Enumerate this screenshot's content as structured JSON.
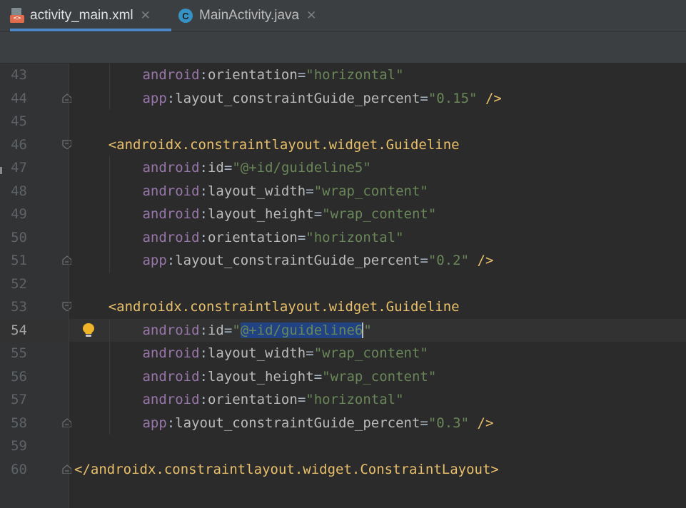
{
  "tabs": [
    {
      "label": "activity_main.xml",
      "icon": "xml-file-icon",
      "active": true,
      "close": "✕"
    },
    {
      "label": "MainActivity.java",
      "icon": "java-class-icon",
      "active": false,
      "close": "✕"
    }
  ],
  "java_icon_letter": "C",
  "xml_icon_text": "<>",
  "editor": {
    "current_line": 54,
    "lines": [
      {
        "n": "43",
        "tokens": [
          [
            "ns",
            "android"
          ],
          [
            "punct",
            ":"
          ],
          [
            "attr",
            "orientation"
          ],
          [
            "punct",
            "="
          ],
          [
            "val",
            "\"horizontal\""
          ]
        ]
      },
      {
        "n": "44",
        "tokens": [
          [
            "ns",
            "app"
          ],
          [
            "punct",
            ":"
          ],
          [
            "attr",
            "layout_constraintGuide_percent"
          ],
          [
            "punct",
            "="
          ],
          [
            "val",
            "\"0.15\""
          ],
          [
            "punct",
            " "
          ],
          [
            "tag",
            "/>"
          ]
        ]
      },
      {
        "n": "45",
        "tokens": []
      },
      {
        "n": "46",
        "tokens": [
          [
            "tag",
            "<androidx.constraintlayout.widget.Guideline"
          ]
        ]
      },
      {
        "n": "47",
        "tokens": [
          [
            "ns",
            "android"
          ],
          [
            "punct",
            ":"
          ],
          [
            "attr",
            "id"
          ],
          [
            "punct",
            "="
          ],
          [
            "val",
            "\"@+id/guideline5\""
          ]
        ]
      },
      {
        "n": "48",
        "tokens": [
          [
            "ns",
            "android"
          ],
          [
            "punct",
            ":"
          ],
          [
            "attr",
            "layout_width"
          ],
          [
            "punct",
            "="
          ],
          [
            "val",
            "\"wrap_content\""
          ]
        ]
      },
      {
        "n": "49",
        "tokens": [
          [
            "ns",
            "android"
          ],
          [
            "punct",
            ":"
          ],
          [
            "attr",
            "layout_height"
          ],
          [
            "punct",
            "="
          ],
          [
            "val",
            "\"wrap_content\""
          ]
        ]
      },
      {
        "n": "50",
        "tokens": [
          [
            "ns",
            "android"
          ],
          [
            "punct",
            ":"
          ],
          [
            "attr",
            "orientation"
          ],
          [
            "punct",
            "="
          ],
          [
            "val",
            "\"horizontal\""
          ]
        ]
      },
      {
        "n": "51",
        "tokens": [
          [
            "ns",
            "app"
          ],
          [
            "punct",
            ":"
          ],
          [
            "attr",
            "layout_constraintGuide_percent"
          ],
          [
            "punct",
            "="
          ],
          [
            "val",
            "\"0.2\""
          ],
          [
            "punct",
            " "
          ],
          [
            "tag",
            "/>"
          ]
        ]
      },
      {
        "n": "52",
        "tokens": []
      },
      {
        "n": "53",
        "tokens": [
          [
            "tag",
            "<androidx.constraintlayout.widget.Guideline"
          ]
        ]
      },
      {
        "n": "54",
        "tokens": [
          [
            "ns",
            "android"
          ],
          [
            "punct",
            ":"
          ],
          [
            "attr",
            "id"
          ],
          [
            "punct",
            "="
          ],
          [
            "val",
            "\""
          ],
          [
            "sel",
            "@+id/guideline6"
          ],
          [
            "caret",
            ""
          ],
          [
            "val",
            "\""
          ]
        ]
      },
      {
        "n": "55",
        "tokens": [
          [
            "ns",
            "android"
          ],
          [
            "punct",
            ":"
          ],
          [
            "attr",
            "layout_width"
          ],
          [
            "punct",
            "="
          ],
          [
            "val",
            "\"wrap_content\""
          ]
        ]
      },
      {
        "n": "56",
        "tokens": [
          [
            "ns",
            "android"
          ],
          [
            "punct",
            ":"
          ],
          [
            "attr",
            "layout_height"
          ],
          [
            "punct",
            "="
          ],
          [
            "val",
            "\"wrap_content\""
          ]
        ]
      },
      {
        "n": "57",
        "tokens": [
          [
            "ns",
            "android"
          ],
          [
            "punct",
            ":"
          ],
          [
            "attr",
            "orientation"
          ],
          [
            "punct",
            "="
          ],
          [
            "val",
            "\"horizontal\""
          ]
        ]
      },
      {
        "n": "58",
        "tokens": [
          [
            "ns",
            "app"
          ],
          [
            "punct",
            ":"
          ],
          [
            "attr",
            "layout_constraintGuide_percent"
          ],
          [
            "punct",
            "="
          ],
          [
            "val",
            "\"0.3\""
          ],
          [
            "punct",
            " "
          ],
          [
            "tag",
            "/>"
          ]
        ]
      },
      {
        "n": "59",
        "tokens": []
      },
      {
        "n": "60",
        "tokens": [
          [
            "tag",
            "</androidx.constraintlayout.widget.ConstraintLayout>"
          ]
        ]
      }
    ]
  },
  "colors": {
    "tag": "#e8bf6a",
    "namespace": "#9876aa",
    "attribute": "#bababa",
    "value": "#6a8759",
    "selection": "#214283",
    "background": "#2b2b2b",
    "tab_underline": "#4a88c7"
  }
}
